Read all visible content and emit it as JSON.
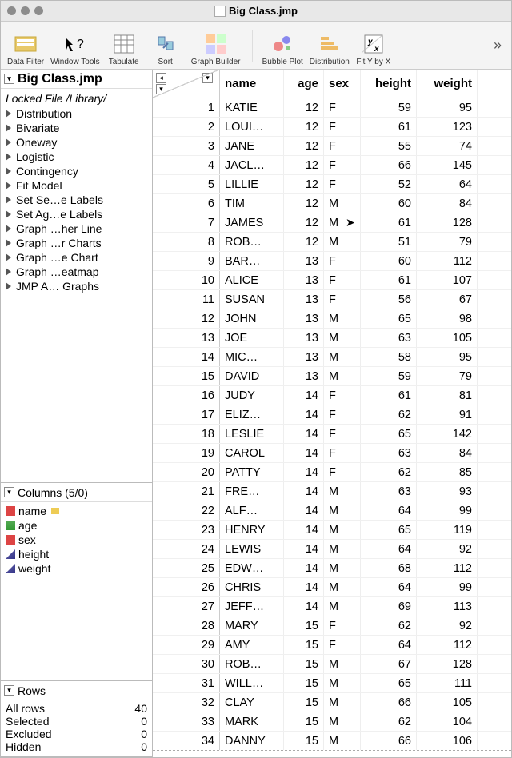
{
  "window": {
    "title": "Big Class.jmp"
  },
  "toolbar": {
    "items": [
      {
        "name": "data-filter",
        "label": "Data Filter"
      },
      {
        "name": "window-tools",
        "label": "Window Tools"
      },
      {
        "name": "tabulate",
        "label": "Tabulate"
      },
      {
        "name": "sort",
        "label": "Sort"
      },
      {
        "name": "graph-builder",
        "label": "Graph Builder"
      },
      {
        "name": "bubble-plot",
        "label": "Bubble Plot"
      },
      {
        "name": "distribution",
        "label": "Distribution"
      },
      {
        "name": "fit-y-by-x",
        "label": "Fit Y by X"
      }
    ]
  },
  "sidebar": {
    "table_title": "Big Class.jmp",
    "locked_text": "Locked File /Library/",
    "scripts": [
      "Distribution",
      "Bivariate",
      "Oneway",
      "Logistic",
      "Contingency",
      "Fit Model",
      "Set Se…e Labels",
      "Set Ag…e Labels",
      "Graph …her Line",
      "Graph …r Charts",
      "Graph …e Chart",
      "Graph …eatmap",
      "JMP A… Graphs"
    ],
    "columns_title": "Columns (5/0)",
    "columns": [
      {
        "name": "name",
        "type": "nominal",
        "label": true
      },
      {
        "name": "age",
        "type": "ordinal",
        "label": false
      },
      {
        "name": "sex",
        "type": "nominal",
        "label": false
      },
      {
        "name": "height",
        "type": "continuous",
        "label": false
      },
      {
        "name": "weight",
        "type": "continuous",
        "label": false
      }
    ],
    "rows_title": "Rows",
    "rows_stats": [
      {
        "label": "All rows",
        "value": "40"
      },
      {
        "label": "Selected",
        "value": "0"
      },
      {
        "label": "Excluded",
        "value": "0"
      },
      {
        "label": "Hidden",
        "value": "0"
      }
    ]
  },
  "grid": {
    "headers": {
      "name": "name",
      "age": "age",
      "sex": "sex",
      "height": "height",
      "weight": "weight"
    },
    "rows": [
      {
        "n": "1",
        "name": "KATIE",
        "age": "12",
        "sex": "F",
        "height": "59",
        "weight": "95"
      },
      {
        "n": "2",
        "name": "LOUI…",
        "age": "12",
        "sex": "F",
        "height": "61",
        "weight": "123"
      },
      {
        "n": "3",
        "name": "JANE",
        "age": "12",
        "sex": "F",
        "height": "55",
        "weight": "74"
      },
      {
        "n": "4",
        "name": "JACL…",
        "age": "12",
        "sex": "F",
        "height": "66",
        "weight": "145"
      },
      {
        "n": "5",
        "name": "LILLIE",
        "age": "12",
        "sex": "F",
        "height": "52",
        "weight": "64"
      },
      {
        "n": "6",
        "name": "TIM",
        "age": "12",
        "sex": "M",
        "height": "60",
        "weight": "84"
      },
      {
        "n": "7",
        "name": "JAMES",
        "age": "12",
        "sex": "M",
        "height": "61",
        "weight": "128"
      },
      {
        "n": "8",
        "name": "ROB…",
        "age": "12",
        "sex": "M",
        "height": "51",
        "weight": "79"
      },
      {
        "n": "9",
        "name": "BAR…",
        "age": "13",
        "sex": "F",
        "height": "60",
        "weight": "112"
      },
      {
        "n": "10",
        "name": "ALICE",
        "age": "13",
        "sex": "F",
        "height": "61",
        "weight": "107"
      },
      {
        "n": "11",
        "name": "SUSAN",
        "age": "13",
        "sex": "F",
        "height": "56",
        "weight": "67"
      },
      {
        "n": "12",
        "name": "JOHN",
        "age": "13",
        "sex": "M",
        "height": "65",
        "weight": "98"
      },
      {
        "n": "13",
        "name": "JOE",
        "age": "13",
        "sex": "M",
        "height": "63",
        "weight": "105"
      },
      {
        "n": "14",
        "name": "MIC…",
        "age": "13",
        "sex": "M",
        "height": "58",
        "weight": "95"
      },
      {
        "n": "15",
        "name": "DAVID",
        "age": "13",
        "sex": "M",
        "height": "59",
        "weight": "79"
      },
      {
        "n": "16",
        "name": "JUDY",
        "age": "14",
        "sex": "F",
        "height": "61",
        "weight": "81"
      },
      {
        "n": "17",
        "name": "ELIZ…",
        "age": "14",
        "sex": "F",
        "height": "62",
        "weight": "91"
      },
      {
        "n": "18",
        "name": "LESLIE",
        "age": "14",
        "sex": "F",
        "height": "65",
        "weight": "142"
      },
      {
        "n": "19",
        "name": "CAROL",
        "age": "14",
        "sex": "F",
        "height": "63",
        "weight": "84"
      },
      {
        "n": "20",
        "name": "PATTY",
        "age": "14",
        "sex": "F",
        "height": "62",
        "weight": "85"
      },
      {
        "n": "21",
        "name": "FRE…",
        "age": "14",
        "sex": "M",
        "height": "63",
        "weight": "93"
      },
      {
        "n": "22",
        "name": "ALF…",
        "age": "14",
        "sex": "M",
        "height": "64",
        "weight": "99"
      },
      {
        "n": "23",
        "name": "HENRY",
        "age": "14",
        "sex": "M",
        "height": "65",
        "weight": "119"
      },
      {
        "n": "24",
        "name": "LEWIS",
        "age": "14",
        "sex": "M",
        "height": "64",
        "weight": "92"
      },
      {
        "n": "25",
        "name": "EDW…",
        "age": "14",
        "sex": "M",
        "height": "68",
        "weight": "112"
      },
      {
        "n": "26",
        "name": "CHRIS",
        "age": "14",
        "sex": "M",
        "height": "64",
        "weight": "99"
      },
      {
        "n": "27",
        "name": "JEFF…",
        "age": "14",
        "sex": "M",
        "height": "69",
        "weight": "113"
      },
      {
        "n": "28",
        "name": "MARY",
        "age": "15",
        "sex": "F",
        "height": "62",
        "weight": "92"
      },
      {
        "n": "29",
        "name": "AMY",
        "age": "15",
        "sex": "F",
        "height": "64",
        "weight": "112"
      },
      {
        "n": "30",
        "name": "ROB…",
        "age": "15",
        "sex": "M",
        "height": "67",
        "weight": "128"
      },
      {
        "n": "31",
        "name": "WILL…",
        "age": "15",
        "sex": "M",
        "height": "65",
        "weight": "111"
      },
      {
        "n": "32",
        "name": "CLAY",
        "age": "15",
        "sex": "M",
        "height": "66",
        "weight": "105"
      },
      {
        "n": "33",
        "name": "MARK",
        "age": "15",
        "sex": "M",
        "height": "62",
        "weight": "104"
      },
      {
        "n": "34",
        "name": "DANNY",
        "age": "15",
        "sex": "M",
        "height": "66",
        "weight": "106"
      }
    ]
  }
}
